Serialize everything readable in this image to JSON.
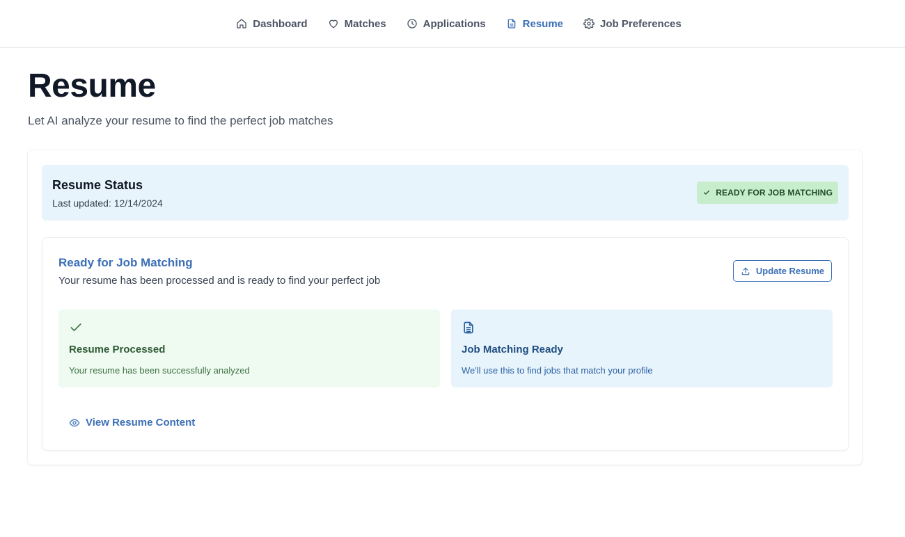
{
  "nav": {
    "items": [
      {
        "label": "Dashboard",
        "icon": "home-icon",
        "active": false
      },
      {
        "label": "Matches",
        "icon": "heart-icon",
        "active": false
      },
      {
        "label": "Applications",
        "icon": "clock-icon",
        "active": false
      },
      {
        "label": "Resume",
        "icon": "document-icon",
        "active": true
      },
      {
        "label": "Job Preferences",
        "icon": "gear-icon",
        "active": false
      }
    ]
  },
  "page": {
    "title": "Resume",
    "subtitle": "Let AI analyze your resume to find the perfect job matches"
  },
  "status": {
    "title": "Resume Status",
    "last_updated": "Last updated: 12/14/2024",
    "badge": "READY FOR JOB MATCHING"
  },
  "ready": {
    "title": "Ready for Job Matching",
    "description": "Your resume has been processed and is ready to find your perfect job",
    "update_button": "Update Resume"
  },
  "tiles": [
    {
      "title": "Resume Processed",
      "description": "Your resume has been successfully analyzed",
      "icon": "check-icon"
    },
    {
      "title": "Job Matching Ready",
      "description": "We'll use this to find jobs that match your profile",
      "icon": "document-icon"
    }
  ],
  "view_link": "View Resume Content",
  "colors": {
    "accent": "#3b6fb6",
    "status_bg": "#e8f4fc",
    "badge_bg": "#c8edcc",
    "success_tile_bg": "#effaf0",
    "info_tile_bg": "#e8f4fc"
  }
}
